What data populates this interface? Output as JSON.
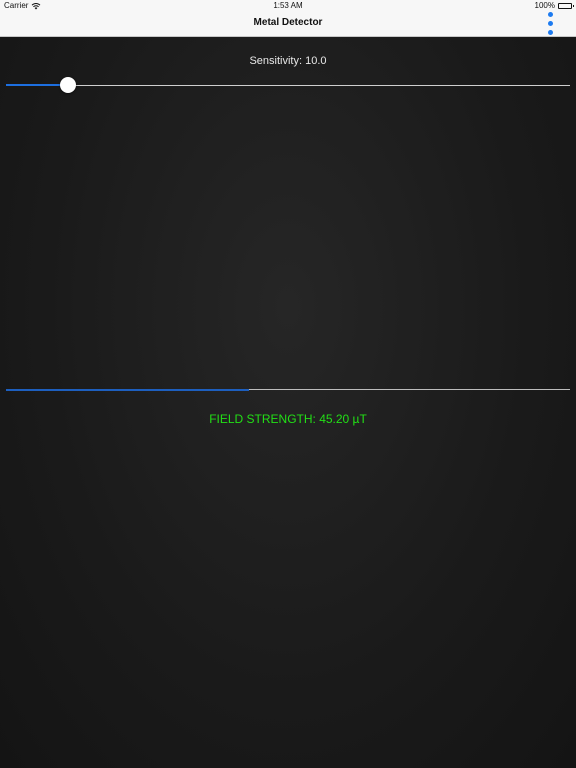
{
  "status_bar": {
    "carrier": "Carrier",
    "time": "1:53 AM",
    "battery": "100%",
    "wifi_icon": "wifi-icon",
    "battery_icon": "battery-icon"
  },
  "nav": {
    "title": "Metal Detector",
    "more_icon": "more-vertical-icon",
    "accent_color": "#1d7bf0"
  },
  "sensitivity": {
    "label": "Sensitivity: 10.0",
    "value_fraction": 0.11,
    "fill_color": "#1d6fe0"
  },
  "field": {
    "label": "FIELD STRENGTH: 45.20 µT",
    "bar_fraction": 0.43,
    "fill_color": "#1d5fbf",
    "text_color": "#22e016"
  }
}
